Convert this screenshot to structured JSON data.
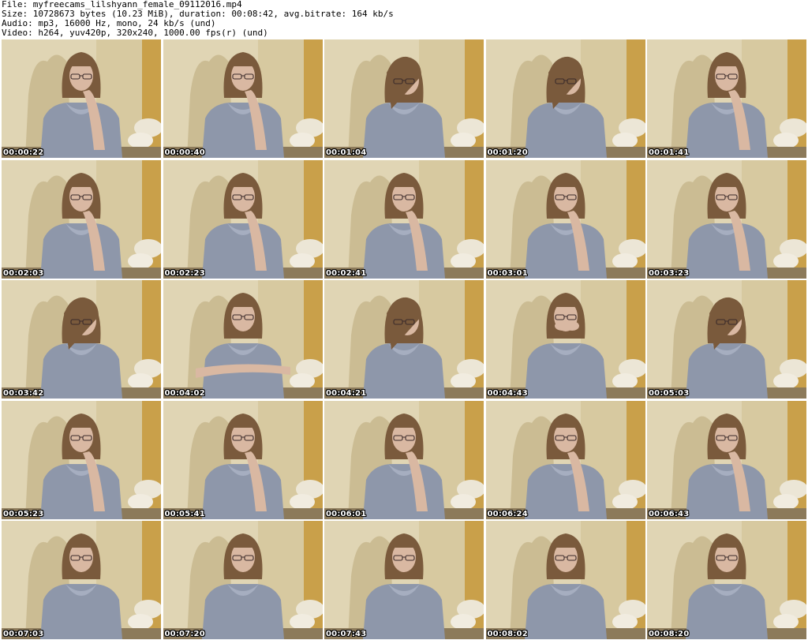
{
  "header": {
    "file_line": "File: myfreecams_lilshyann_female_09112016.mp4",
    "size_line": "Size: 10728673 bytes (10.23 MiB), duration: 00:08:42, avg.bitrate: 164 kb/s",
    "audio_line": "Audio: mp3, 16000 Hz, mono, 24 kb/s (und)",
    "video_line": "Video: h264, yuv420p, 320x240, 1000.00 fps(r) (und)"
  },
  "colors": {
    "wall": "#d7c9a0",
    "wall_light": "#e8dfc4",
    "shadow": "#b9a878",
    "right_wall": "#c9a04a",
    "hoodie": "#8e97aa",
    "hair": "#7a5a3c",
    "skin": "#d9b8a2",
    "carpet": "#8c7a5a"
  },
  "thumbnails": [
    {
      "timestamp": "00:00:22",
      "pose": "hand-chin"
    },
    {
      "timestamp": "00:00:40",
      "pose": "hand-chin"
    },
    {
      "timestamp": "00:01:04",
      "pose": "looking-down"
    },
    {
      "timestamp": "00:01:20",
      "pose": "looking-down"
    },
    {
      "timestamp": "00:01:41",
      "pose": "hand-chin"
    },
    {
      "timestamp": "00:02:03",
      "pose": "hand-chin"
    },
    {
      "timestamp": "00:02:23",
      "pose": "hand-chin"
    },
    {
      "timestamp": "00:02:41",
      "pose": "hand-chin"
    },
    {
      "timestamp": "00:03:01",
      "pose": "hand-chin"
    },
    {
      "timestamp": "00:03:23",
      "pose": "hand-chin"
    },
    {
      "timestamp": "00:03:42",
      "pose": "looking-down"
    },
    {
      "timestamp": "00:04:02",
      "pose": "arms-crossed"
    },
    {
      "timestamp": "00:04:21",
      "pose": "looking-down"
    },
    {
      "timestamp": "00:04:43",
      "pose": "hands-face"
    },
    {
      "timestamp": "00:05:03",
      "pose": "looking-down"
    },
    {
      "timestamp": "00:05:23",
      "pose": "hand-chin"
    },
    {
      "timestamp": "00:05:41",
      "pose": "hand-chin"
    },
    {
      "timestamp": "00:06:01",
      "pose": "hand-chin"
    },
    {
      "timestamp": "00:06:24",
      "pose": "hand-chin"
    },
    {
      "timestamp": "00:06:43",
      "pose": "hand-chin"
    },
    {
      "timestamp": "00:07:03",
      "pose": "neutral"
    },
    {
      "timestamp": "00:07:20",
      "pose": "neutral"
    },
    {
      "timestamp": "00:07:43",
      "pose": "neutral"
    },
    {
      "timestamp": "00:08:02",
      "pose": "neutral"
    },
    {
      "timestamp": "00:08:20",
      "pose": "neutral"
    }
  ]
}
